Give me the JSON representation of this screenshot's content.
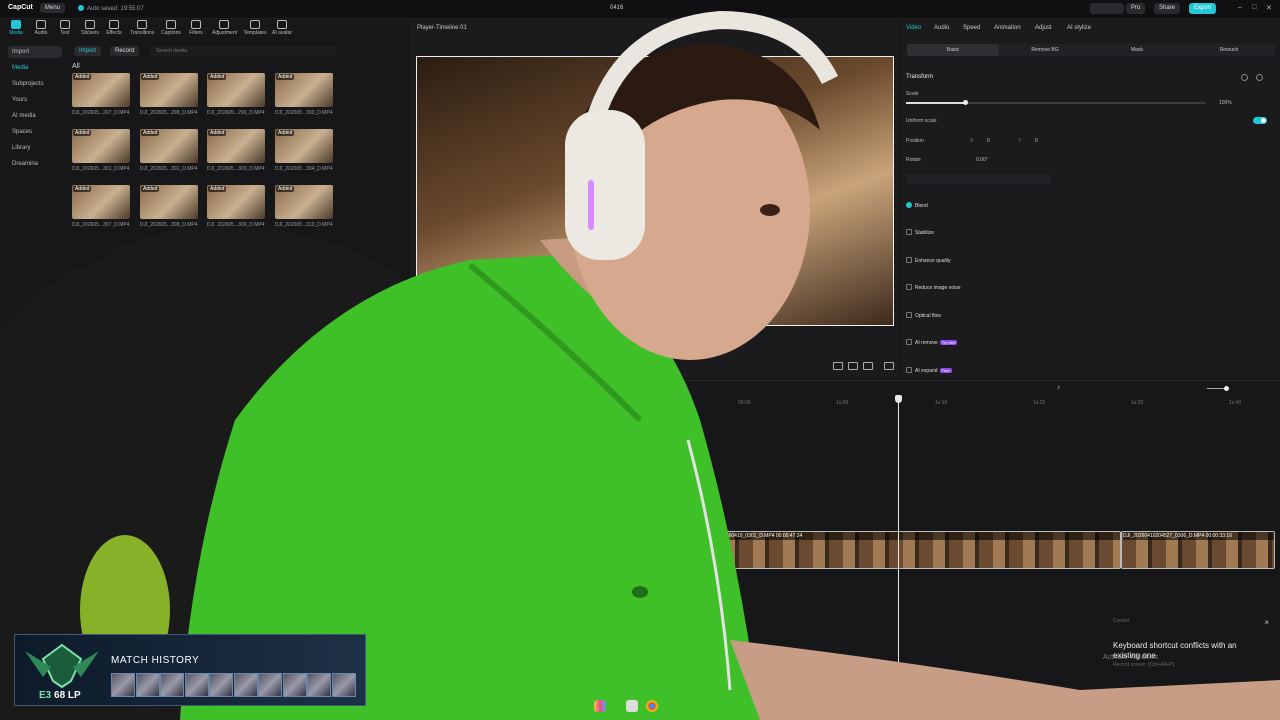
{
  "topbar": {
    "app_name": "CapCut",
    "menu_label": "Menu",
    "autosave": "Auto saved: 19:55:07",
    "project_name": "0416",
    "pro_label": "Pro",
    "share_label": "Share",
    "export_label": "Export",
    "accent": "#22c7d6"
  },
  "toolbar": {
    "items": [
      {
        "label": "Media",
        "icon": "media-icon"
      },
      {
        "label": "Audio",
        "icon": "audio-icon"
      },
      {
        "label": "Text",
        "icon": "text-icon"
      },
      {
        "label": "Stickers",
        "icon": "sticker-icon"
      },
      {
        "label": "Effects",
        "icon": "effects-icon"
      },
      {
        "label": "Transitions",
        "icon": "transitions-icon"
      },
      {
        "label": "Captions",
        "icon": "captions-icon"
      },
      {
        "label": "Filters",
        "icon": "filters-icon"
      },
      {
        "label": "Adjustment",
        "icon": "adjustment-icon"
      },
      {
        "label": "Templates",
        "icon": "templates-icon"
      },
      {
        "label": "AI avatar",
        "icon": "avatar-icon"
      }
    ]
  },
  "leftnav": {
    "items": [
      "Import",
      "Media",
      "Subprojects",
      "Yours",
      "AI media",
      "Spaces",
      "Library",
      "Dreamina"
    ]
  },
  "media": {
    "import_label": "Import",
    "record_label": "Record",
    "search_placeholder": "Search media",
    "all_label": "All",
    "added_label": "Added",
    "thumbs": [
      {
        "label": "DJI_202605...297_D.MP4",
        "dur": ""
      },
      {
        "label": "DJI_202605...298_D.MP4",
        "dur": ""
      },
      {
        "label": "DJI_202605...299_D.MP4",
        "dur": ""
      },
      {
        "label": "DJI_202605...300_D.MP4",
        "dur": ""
      },
      {
        "label": "DJI_202605...301_D.MP4",
        "dur": ""
      },
      {
        "label": "DJI_202605...302_D.MP4",
        "dur": ""
      },
      {
        "label": "DJI_202605...303_D.MP4",
        "dur": ""
      },
      {
        "label": "DJI_202605...304_D.MP4",
        "dur": ""
      },
      {
        "label": "DJI_202605...307_D.MP4",
        "dur": ""
      },
      {
        "label": "DJI_202605...308_D.MP4",
        "dur": ""
      },
      {
        "label": "DJI_202605...309_D.MP4",
        "dur": ""
      },
      {
        "label": "DJI_202605...310_D.MP4",
        "dur": ""
      }
    ]
  },
  "player": {
    "title": "Player-Timeline 01"
  },
  "right": {
    "tabs": [
      "Video",
      "Audio",
      "Speed",
      "Animation",
      "Adjust",
      "AI stylize"
    ],
    "subtabs": [
      "Basic",
      "Remove BG",
      "Mask",
      "Retouch"
    ],
    "transform_label": "Transform",
    "scale_label": "Scale",
    "scale_value": "100%",
    "scale_level": 0.3,
    "uniform_label": "Uniform scale",
    "position_label": "Position",
    "pos_x_label": "X",
    "pos_x": "0",
    "pos_y_label": "Y",
    "pos_y": "0",
    "rotate_label": "Rotate",
    "rotate_value": "0.00°",
    "sections": [
      {
        "label": "Blend",
        "on": true,
        "badge": ""
      },
      {
        "label": "Stabilize",
        "on": false,
        "badge": ""
      },
      {
        "label": "Enhance quality",
        "on": false,
        "badge": ""
      },
      {
        "label": "Reduce image noise",
        "on": false,
        "badge": ""
      },
      {
        "label": "Optical flow",
        "on": false,
        "badge": ""
      },
      {
        "label": "AI remove",
        "on": false,
        "badge": "Try free"
      },
      {
        "label": "AI expand",
        "on": false,
        "badge": "Free"
      }
    ]
  },
  "timeline": {
    "ticks": [
      "00:00",
      "1s:00",
      "1s:10",
      "1s:20",
      "1s:30",
      "1s:40"
    ],
    "clips": [
      {
        "label": "DJI_20260410_0301_D.MP4   00:00:47:24"
      },
      {
        "label": "DJI_20260410204527_0306_D.MP4   00:00:33:16"
      }
    ]
  },
  "toast": {
    "header": "Creator",
    "message": "Keyboard shortcut conflicts with an existing one",
    "watermark": "Activate Windows",
    "shortcut": "Record screen: [Ctrl+Alt+P]"
  },
  "overlay": {
    "title": "MATCH HISTORY",
    "rank": "E3",
    "lp": "68 LP",
    "champions": 10
  }
}
